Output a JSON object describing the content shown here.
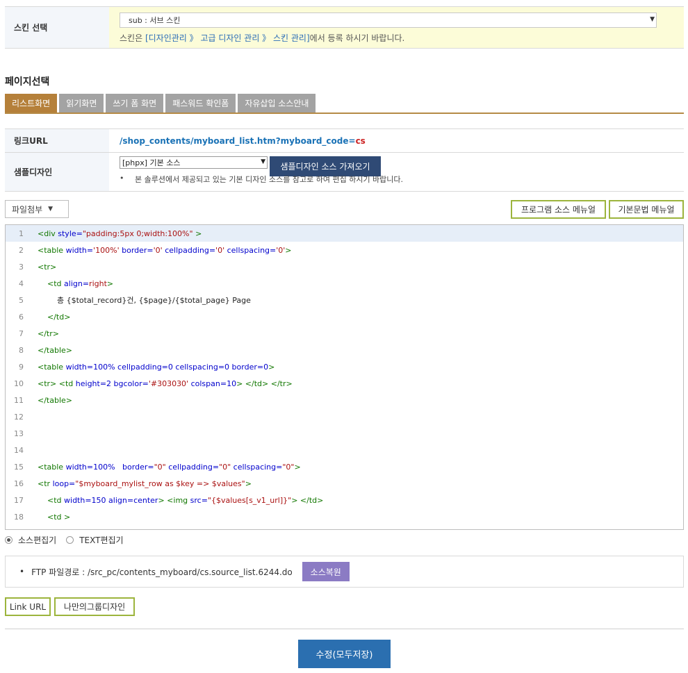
{
  "skin": {
    "label": "스킨 선택",
    "selected": "sub : 서브 스킨",
    "help_prefix": "스킨은 ",
    "help_link": "[디자인관리 》 고급 디자인 관리 》 스킨 관리]",
    "help_suffix": "에서 등록 하시기 바랍니다."
  },
  "page_select": {
    "title": "페이지선택",
    "tabs": [
      {
        "label": "리스트화면",
        "active": true
      },
      {
        "label": "읽기화면"
      },
      {
        "label": "쓰기 폼 화면"
      },
      {
        "label": "패스워드 확인폼"
      },
      {
        "label": "자유삽입 소스안내"
      }
    ]
  },
  "link_url": {
    "label": "링크URL",
    "path": "/shop_contents/myboard_list.htm?myboard_code=",
    "code": "cs"
  },
  "sample": {
    "label": "샘플디자인",
    "selected": "[phpx] 기본 소스",
    "button": "샘플디자인 소스 가져오기",
    "note": "본 솔루션에서 제공되고 있는 기본 디자인 소스를 참고로 하여 편집 하시기 바랍니다."
  },
  "toolbar": {
    "attach": "파일첨부",
    "program_manual": "프로그램 소스 메뉴얼",
    "basic_manual": "기본문법 메뉴얼"
  },
  "code": [
    {
      "n": "1",
      "parts": [
        [
          "tag",
          "<div "
        ],
        [
          "attr",
          "style="
        ],
        [
          "str",
          "\"padding:5px 0;width:100%\""
        ],
        [
          "tag",
          " >"
        ]
      ]
    },
    {
      "n": "2",
      "parts": [
        [
          "tag",
          "<table "
        ],
        [
          "attr",
          "width="
        ],
        [
          "str",
          "'100%'"
        ],
        [
          "attr",
          " border="
        ],
        [
          "str",
          "'0'"
        ],
        [
          "attr",
          " cellpadding="
        ],
        [
          "str",
          "'0'"
        ],
        [
          "attr",
          " cellspacing="
        ],
        [
          "str",
          "'0'"
        ],
        [
          "tag",
          ">"
        ]
      ]
    },
    {
      "n": "3",
      "parts": [
        [
          "tag",
          "<tr>"
        ]
      ]
    },
    {
      "n": "4",
      "parts": [
        [
          "plain",
          "    "
        ],
        [
          "tag",
          "<td "
        ],
        [
          "attr",
          "align="
        ],
        [
          "str",
          "right"
        ],
        [
          "tag",
          ">"
        ]
      ]
    },
    {
      "n": "5",
      "parts": [
        [
          "plain",
          "        총 {$total_record}건, {$page}/{$total_page} Page"
        ]
      ]
    },
    {
      "n": "6",
      "parts": [
        [
          "plain",
          "    "
        ],
        [
          "tag",
          "</td>"
        ]
      ]
    },
    {
      "n": "7",
      "parts": [
        [
          "tag",
          "</tr>"
        ]
      ]
    },
    {
      "n": "8",
      "parts": [
        [
          "tag",
          "</table>"
        ]
      ]
    },
    {
      "n": "9",
      "parts": [
        [
          "tag",
          "<table "
        ],
        [
          "attr",
          "width=100% cellpadding=0 cellspacing=0 border=0"
        ],
        [
          "tag",
          ">"
        ]
      ]
    },
    {
      "n": "10",
      "parts": [
        [
          "tag",
          "<tr> <td "
        ],
        [
          "attr",
          "height=2 bgcolor="
        ],
        [
          "str",
          "'#303030'"
        ],
        [
          "attr",
          " colspan=10"
        ],
        [
          "tag",
          "> </td> </tr>"
        ]
      ]
    },
    {
      "n": "11",
      "parts": [
        [
          "tag",
          "</table>"
        ]
      ]
    },
    {
      "n": "12",
      "parts": []
    },
    {
      "n": "13",
      "parts": []
    },
    {
      "n": "14",
      "parts": []
    },
    {
      "n": "15",
      "parts": [
        [
          "tag",
          "<table "
        ],
        [
          "attr",
          "width=100%   border="
        ],
        [
          "str",
          "\"0\""
        ],
        [
          "attr",
          " cellpadding="
        ],
        [
          "str",
          "\"0\""
        ],
        [
          "attr",
          " cellspacing="
        ],
        [
          "str",
          "\"0\""
        ],
        [
          "tag",
          ">"
        ]
      ]
    },
    {
      "n": "16",
      "parts": [
        [
          "tag",
          "<tr "
        ],
        [
          "attr",
          "loop="
        ],
        [
          "str",
          "\"$myboard_mylist_row as $key => $values\""
        ],
        [
          "tag",
          ">"
        ]
      ]
    },
    {
      "n": "17",
      "parts": [
        [
          "plain",
          "    "
        ],
        [
          "tag",
          "<td "
        ],
        [
          "attr",
          "width=150 align=center"
        ],
        [
          "tag",
          "> <img "
        ],
        [
          "attr",
          "src="
        ],
        [
          "str",
          "\"{$values[s_v1_url]}\""
        ],
        [
          "tag",
          "> </td>"
        ]
      ]
    },
    {
      "n": "18",
      "parts": [
        [
          "plain",
          "    "
        ],
        [
          "tag",
          "<td >"
        ]
      ]
    }
  ],
  "editor_mode": {
    "source": "소스편집기",
    "text": "TEXT편집기",
    "selected": "source"
  },
  "ftp": {
    "label": "FTP 파일경로 : /src_pc/contents_myboard/cs.source_list.6244.do",
    "restore": "소스복원"
  },
  "bottom": {
    "link_url": "Link URL",
    "group_design": "나만의그룹디자인",
    "save": "수정(모두저장)"
  },
  "colors": {
    "tab_active": "#b5803a",
    "tab_inactive": "#a3a3a3",
    "accent_blue": "#2b6fb0",
    "olive_border": "#9cb43c",
    "navy_button": "#2f4a75",
    "purple_button": "#8b7bc4"
  }
}
